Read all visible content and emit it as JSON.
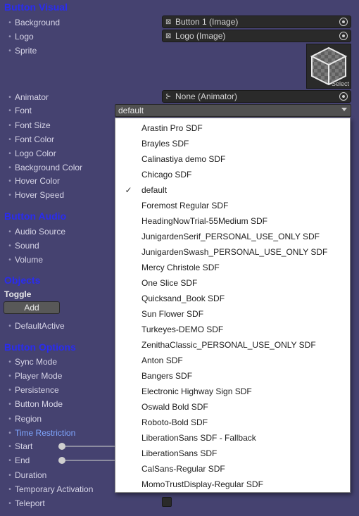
{
  "sections": {
    "button_visual": "Button Visual",
    "button_audio": "Button Audio",
    "objects": "Objects",
    "button_options": "Button Options"
  },
  "visual": {
    "background_label": "Background",
    "background_value": "Button 1 (Image)",
    "logo_label": "Logo",
    "logo_value": "Logo (Image)",
    "sprite_label": "Sprite",
    "sprite_select": "Select",
    "animator_label": "Animator",
    "animator_value": "None (Animator)",
    "font_label": "Font",
    "font_value": "default",
    "font_size_label": "Font Size",
    "font_color_label": "Font Color",
    "logo_color_label": "Logo Color",
    "background_color_label": "Background Color",
    "hover_color_label": "Hover Color",
    "hover_speed_label": "Hover Speed"
  },
  "audio": {
    "audio_source_label": "Audio Source",
    "sound_label": "Sound",
    "volume_label": "Volume"
  },
  "objects": {
    "toggle_label": "Toggle",
    "add_label": "Add",
    "default_active_label": "DefaultActive"
  },
  "options": {
    "sync_mode_label": "Sync Mode",
    "player_mode_label": "Player Mode",
    "persistence_label": "Persistence",
    "button_mode_label": "Button Mode",
    "region_label": "Region",
    "time_restriction_label": "Time Restriction",
    "start_label": "Start",
    "end_label": "End",
    "duration_label": "Duration",
    "temporary_activation_label": "Temporary Activation",
    "teleport_label": "Teleport"
  },
  "font_menu": {
    "selected": "default",
    "items": [
      "Arastin Pro SDF",
      "Brayles SDF",
      "Calinastiya demo SDF",
      "Chicago SDF",
      "default",
      "Foremost Regular SDF",
      "HeadingNowTrial-55Medium SDF",
      "JunigardenSerif_PERSONAL_USE_ONLY SDF",
      "JunigardenSwash_PERSONAL_USE_ONLY SDF",
      "Mercy Christole SDF",
      "One Slice SDF",
      "Quicksand_Book SDF",
      "Sun Flower SDF",
      "Turkeyes-DEMO SDF",
      "ZenithaClassic_PERSONAL_USE_ONLY SDF",
      "Anton SDF",
      "Bangers SDF",
      "Electronic Highway Sign SDF",
      "Oswald Bold SDF",
      "Roboto-Bold SDF",
      "LiberationSans SDF - Fallback",
      "LiberationSans SDF",
      "CalSans-Regular SDF",
      "MomoTrustDisplay-Regular SDF"
    ]
  },
  "colors": {
    "background": "#454270",
    "section_header": "#2a2cf0",
    "highlight_label": "#7fa6ff"
  }
}
